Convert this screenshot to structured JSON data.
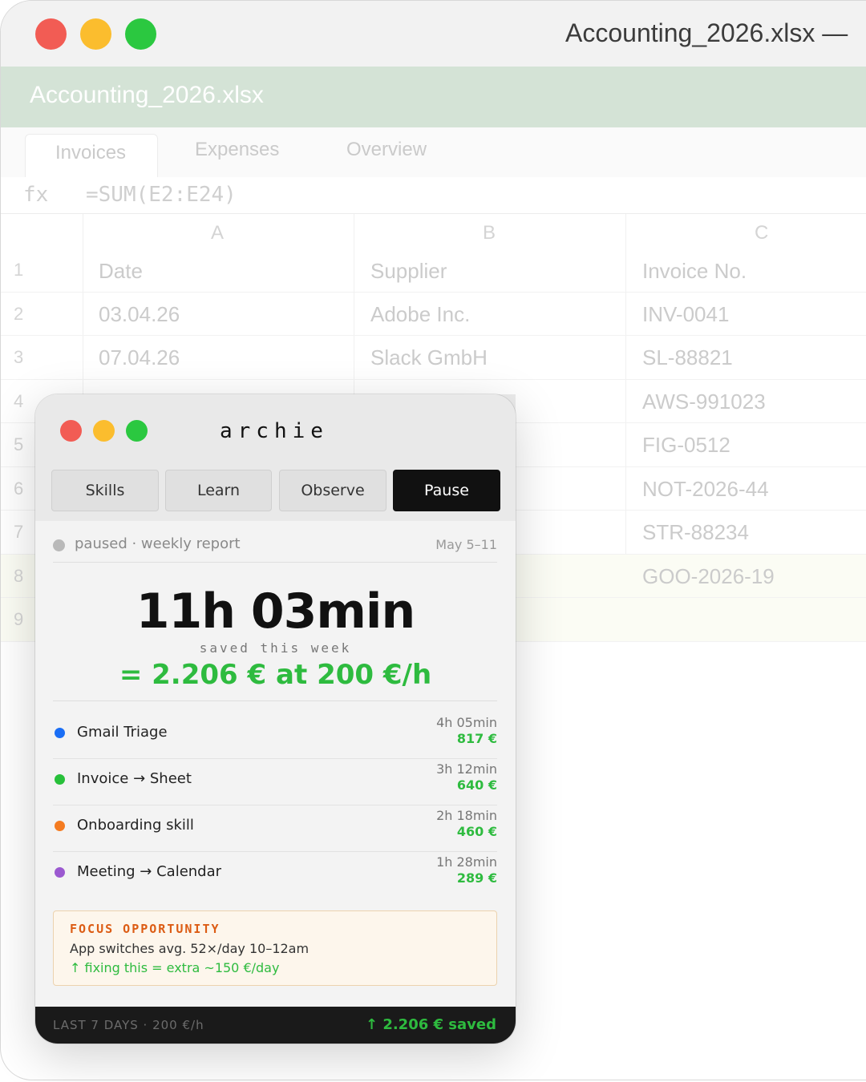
{
  "spreadsheet": {
    "window_title": "Accounting_2026.xlsx —",
    "filename": "Accounting_2026.xlsx",
    "tabs": [
      {
        "label": "Invoices",
        "active": true
      },
      {
        "label": "Expenses",
        "active": false
      },
      {
        "label": "Overview",
        "active": false
      }
    ],
    "formula": {
      "fx_label": "fx",
      "value": "=SUM(E2:E24)"
    },
    "columns": [
      "A",
      "B",
      "C"
    ],
    "header_row": {
      "num": "1",
      "cells": [
        "Date",
        "Supplier",
        "Invoice No."
      ]
    },
    "rows": [
      {
        "num": "2",
        "cells": [
          "03.04.26",
          "Adobe Inc.",
          "INV-0041"
        ]
      },
      {
        "num": "3",
        "cells": [
          "07.04.26",
          "Slack GmbH",
          "SL-88821"
        ]
      },
      {
        "num": "4",
        "cells": [
          "",
          "",
          "AWS-991023"
        ]
      },
      {
        "num": "5",
        "cells": [
          "",
          "",
          "FIG-0512"
        ]
      },
      {
        "num": "6",
        "cells": [
          "",
          "",
          "NOT-2026-44"
        ]
      },
      {
        "num": "7",
        "cells": [
          "",
          "",
          "STR-88234"
        ]
      },
      {
        "num": "8",
        "cells": [
          "",
          "",
          "GOO-2026-19"
        ]
      },
      {
        "num": "9",
        "cells": [
          "",
          "",
          ""
        ]
      }
    ]
  },
  "archie": {
    "title": "archie",
    "toolbar": {
      "skills_label": "Skills",
      "learn_label": "Learn",
      "observe_label": "Observe",
      "pause_label": "Pause"
    },
    "status": {
      "text": "paused · weekly report",
      "date_range": "May 5–11"
    },
    "summary": {
      "time_saved": "11h 03min",
      "saved_label": "saved this week",
      "money_line": "= 2.206 € at 200 €/h"
    },
    "skills": [
      {
        "name": "Gmail Triage",
        "time": "4h 05min",
        "money": "817 €",
        "color": "#1a6ef5"
      },
      {
        "name": "Invoice → Sheet",
        "time": "3h 12min",
        "money": "640 €",
        "color": "#27c03a"
      },
      {
        "name": "Onboarding skill",
        "time": "2h 18min",
        "money": "460 €",
        "color": "#f47b20"
      },
      {
        "name": "Meeting → Calendar",
        "time": "1h 28min",
        "money": "289 €",
        "color": "#9b59d0"
      }
    ],
    "focus": {
      "title": "FOCUS OPPORTUNITY",
      "line1": "App switches avg. 52×/day 10–12am",
      "line2": "↑ fixing this = extra ~150 €/day"
    },
    "footer": {
      "left": "LAST 7 DAYS · 200 €/h",
      "right": "↑ 2.206 € saved"
    },
    "colors": {
      "accent_green": "#2ebb3f",
      "focus_orange": "#dc5c14",
      "pause_button": "#111111"
    }
  }
}
